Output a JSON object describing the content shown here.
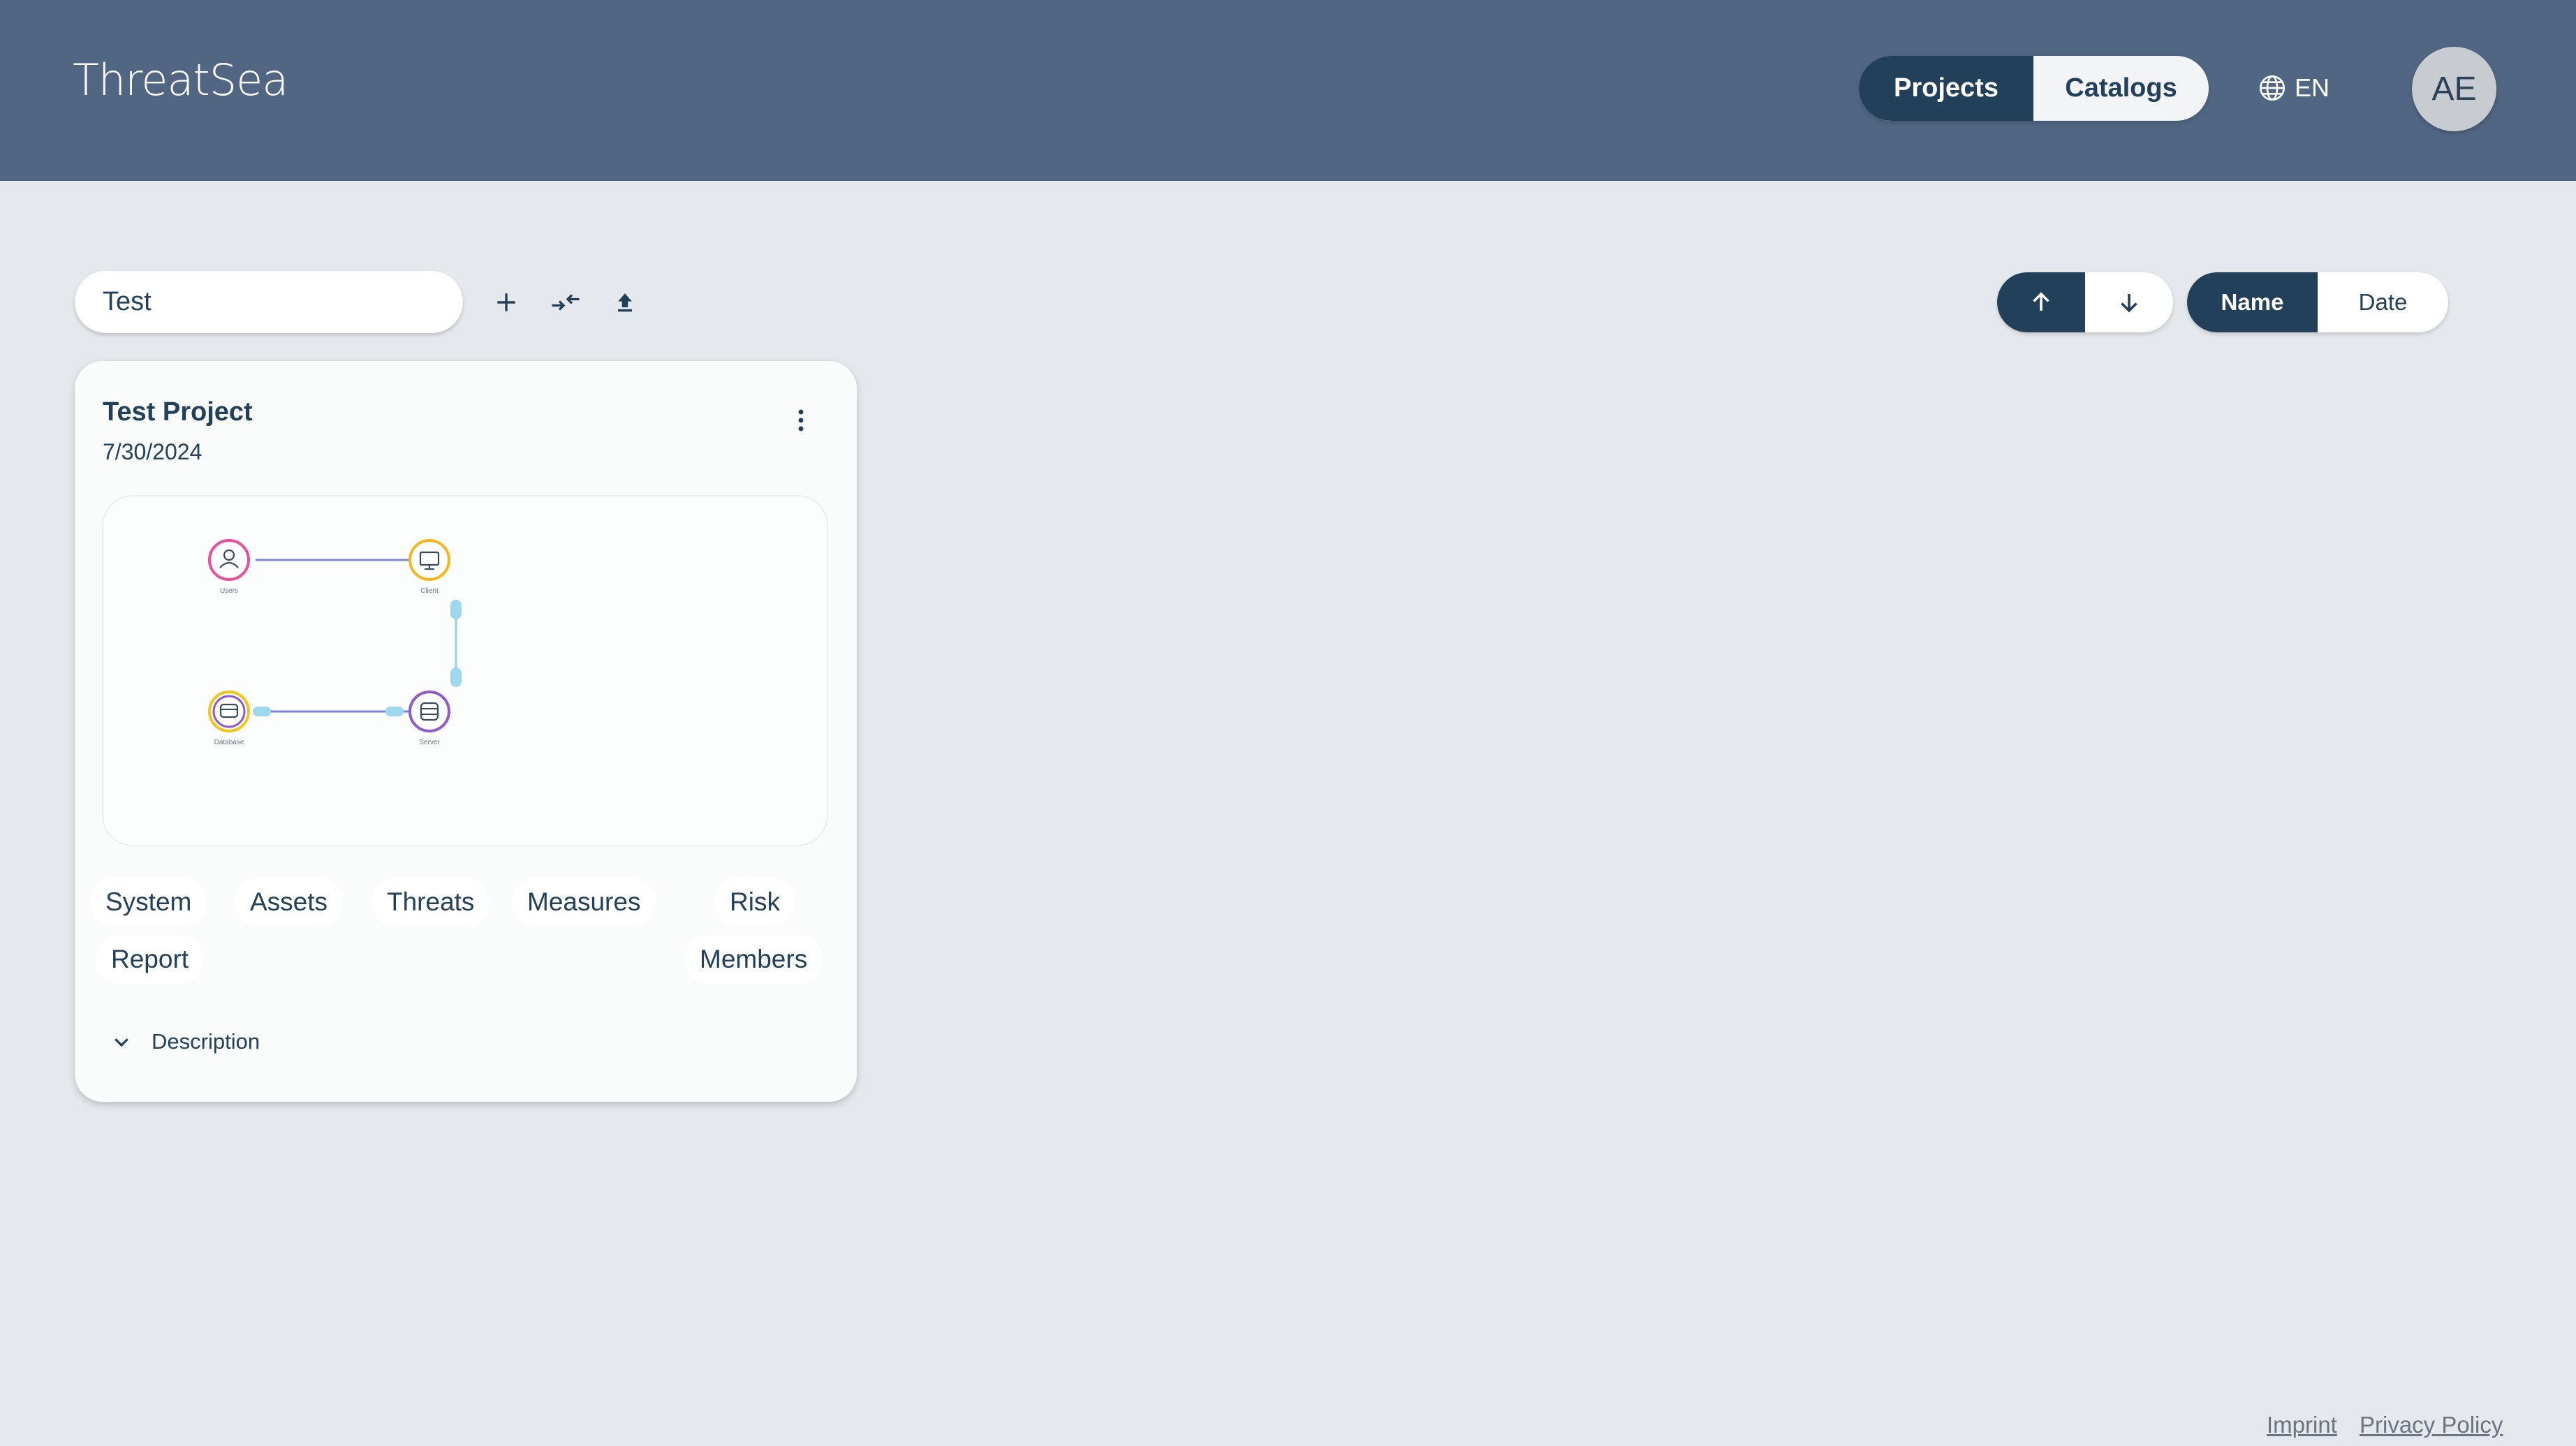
{
  "header": {
    "logo": "ThreatSea",
    "nav": {
      "projects": "Projects",
      "catalogs": "Catalogs"
    },
    "language": "EN",
    "avatar_initials": "AE"
  },
  "toolbar": {
    "search_value": "Test",
    "search_icon": "search-icon",
    "add_icon": "plus-icon",
    "import_icon": "import-icon",
    "upload_icon": "upload-icon"
  },
  "sort": {
    "direction_up_icon": "arrow-up-icon",
    "direction_down_icon": "arrow-down-icon",
    "name": "Name",
    "date": "Date"
  },
  "project": {
    "title": "Test Project",
    "date": "7/30/2024",
    "diagram": {
      "nodes": [
        {
          "label": "Users",
          "color": "#e94f9a"
        },
        {
          "label": "Client",
          "color": "#f2b81d"
        },
        {
          "label": "Database",
          "color": "#f2c51d"
        },
        {
          "label": "Server",
          "color": "#8e5cc8"
        }
      ]
    },
    "links": {
      "system": "System",
      "assets": "Assets",
      "threats": "Threats",
      "measures": "Measures",
      "risk": "Risk",
      "report": "Report",
      "members": "Members"
    },
    "description_label": "Description"
  },
  "footer": {
    "imprint": "Imprint",
    "privacy": "Privacy Policy"
  },
  "colors": {
    "header": "#506683",
    "primary": "#23405a",
    "background": "#e5e8ec",
    "search_icon": "#f0a400"
  }
}
